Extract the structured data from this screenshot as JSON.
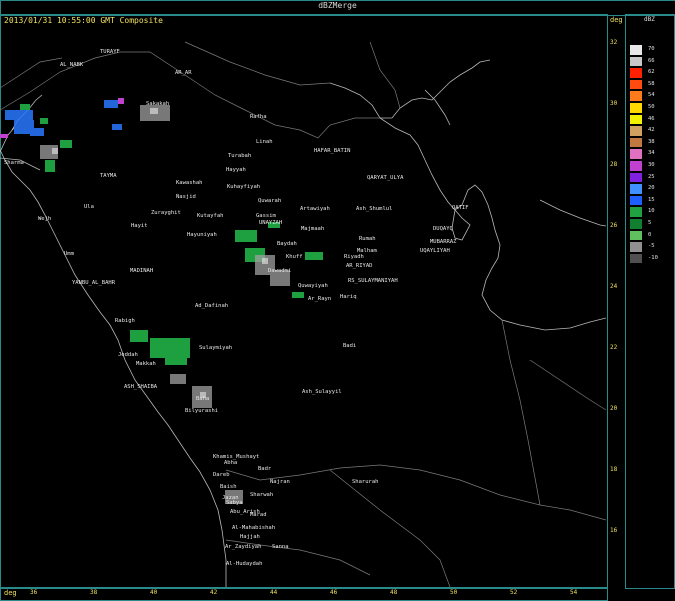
{
  "header": {
    "title": "dBZMerge",
    "timestamp": "2013/01/31 10:55:00 GMT Composite",
    "unit_right": "deg",
    "unit_bottom": "deg"
  },
  "legend": {
    "title": "dBZ",
    "entries": [
      {
        "label": "70",
        "color": "#e8e8e8"
      },
      {
        "label": "66",
        "color": "#c8c8c8"
      },
      {
        "label": "62",
        "color": "#ff2000"
      },
      {
        "label": "58",
        "color": "#ff4a10"
      },
      {
        "label": "54",
        "color": "#ff7a1a"
      },
      {
        "label": "50",
        "color": "#ffd800"
      },
      {
        "label": "46",
        "color": "#f0f000"
      },
      {
        "label": "42",
        "color": "#d0a060"
      },
      {
        "label": "38",
        "color": "#c07840"
      },
      {
        "label": "34",
        "color": "#e070c0"
      },
      {
        "label": "30",
        "color": "#c040d0"
      },
      {
        "label": "25",
        "color": "#8020e0"
      },
      {
        "label": "20",
        "color": "#4090ff"
      },
      {
        "label": "15",
        "color": "#1e60ff"
      },
      {
        "label": "10",
        "color": "#20a040"
      },
      {
        "label": "5",
        "color": "#108030"
      },
      {
        "label": "0",
        "color": "#60c060"
      },
      {
        "label": "-5",
        "color": "#909090"
      },
      {
        "label": "-10",
        "color": "#505050"
      }
    ]
  },
  "axes": {
    "lat_labels": [
      "32",
      "30",
      "28",
      "26",
      "24",
      "22",
      "20",
      "18",
      "16"
    ],
    "lon_labels": [
      "36",
      "38",
      "40",
      "42",
      "44",
      "46",
      "48",
      "50",
      "52",
      "54"
    ]
  },
  "cities": [
    {
      "name": "TURAYF"
    },
    {
      "name": "AR_AR"
    },
    {
      "name": "AL_NABK"
    },
    {
      "name": "Sakakah"
    },
    {
      "name": "Rafha"
    },
    {
      "name": "Linah"
    },
    {
      "name": "HAFAR_BATIN"
    },
    {
      "name": "Turabah"
    },
    {
      "name": "Hayyah"
    },
    {
      "name": "QARYAT_ULYA"
    },
    {
      "name": "TAYMA"
    },
    {
      "name": "Kawashah"
    },
    {
      "name": "Nasjid"
    },
    {
      "name": "Kuhayfiyah"
    },
    {
      "name": "Quwarah"
    },
    {
      "name": "Sharma"
    },
    {
      "name": "Ula"
    },
    {
      "name": "Artawiyah"
    },
    {
      "name": "Ash_Shumlul"
    },
    {
      "name": "Wejh"
    },
    {
      "name": "Zurayghit"
    },
    {
      "name": "Kutayfah"
    },
    {
      "name": "Gassim"
    },
    {
      "name": "UNAYZAH"
    },
    {
      "name": "Majmaah"
    },
    {
      "name": "Hayit"
    },
    {
      "name": "Hayuniyah"
    },
    {
      "name": "Rumah"
    },
    {
      "name": "Umm"
    },
    {
      "name": "Baydah"
    },
    {
      "name": "Malham"
    },
    {
      "name": "Khuff"
    },
    {
      "name": "Riyadh"
    },
    {
      "name": "AR_RIYAD"
    },
    {
      "name": "MADINAH"
    },
    {
      "name": "Dawadmi"
    },
    {
      "name": "RS_SULAYMANIYAH"
    },
    {
      "name": "YANBU_AL_BAHR"
    },
    {
      "name": "Quwayiyah"
    },
    {
      "name": "Ar_Rayn"
    },
    {
      "name": "Hariq"
    },
    {
      "name": "Ad_Dafinah"
    },
    {
      "name": "Rabigh"
    },
    {
      "name": "Sulaymiyah"
    },
    {
      "name": "Badi"
    },
    {
      "name": "Jeddah"
    },
    {
      "name": "Makkah"
    },
    {
      "name": "ASH_SHAIBA"
    },
    {
      "name": "Ash_Sulayyil"
    },
    {
      "name": "Baha"
    },
    {
      "name": "Bilyurashi"
    },
    {
      "name": "Khamis_Mushayt"
    },
    {
      "name": "Abha"
    },
    {
      "name": "Badr"
    },
    {
      "name": "Dareb"
    },
    {
      "name": "Najran"
    },
    {
      "name": "Sharurah"
    },
    {
      "name": "Baish"
    },
    {
      "name": "Jazan"
    },
    {
      "name": "Sharwah"
    },
    {
      "name": "Sabya"
    },
    {
      "name": "Abu_Arish"
    },
    {
      "name": "Marad"
    },
    {
      "name": "Al-Mahabishah"
    },
    {
      "name": "Hajjah"
    },
    {
      "name": "Ar_Zaydiyah"
    },
    {
      "name": "Sanna"
    },
    {
      "name": "Al-Hudaydah"
    },
    {
      "name": "DUQAYQ"
    },
    {
      "name": "QATIF"
    },
    {
      "name": "MUBARRAZ"
    },
    {
      "name": "UQAYLIYAH"
    }
  ]
}
